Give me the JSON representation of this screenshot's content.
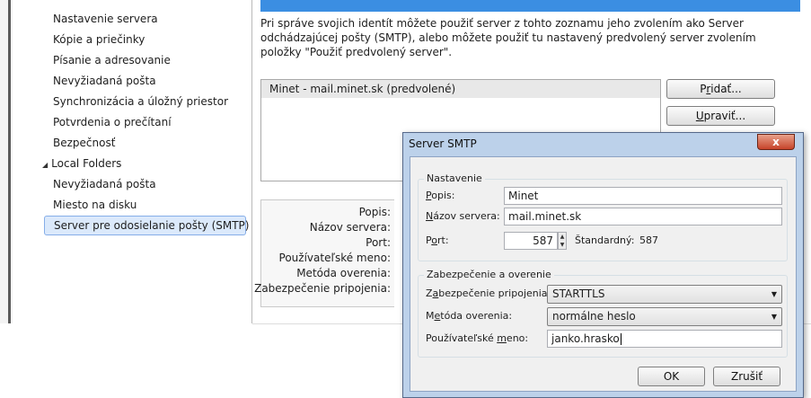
{
  "tree": {
    "items": [
      {
        "label": "Nastavenie servera"
      },
      {
        "label": "Kópie a priečinky"
      },
      {
        "label": "Písanie a adresovanie"
      },
      {
        "label": "Nevyžiadaná pošta"
      },
      {
        "label": "Synchronizácia a úložný priestor"
      },
      {
        "label": "Potvrdenia o prečítaní"
      },
      {
        "label": "Bezpečnosť"
      }
    ],
    "root": {
      "label": "Local Folders",
      "arrow": "◢"
    },
    "local_items": [
      {
        "label": "Nevyžiadaná pošta"
      },
      {
        "label": "Miesto na disku"
      }
    ],
    "selected": {
      "label": "Server pre odosielanie pošty (SMTP)"
    }
  },
  "main": {
    "description": "Pri správe svojich identít môžete použiť server z tohto zoznamu jeho zvolením ako Server odchádzajúcej pošty (SMTP), alebo môžete použiť tu nastavený predvolený server zvolením položky \"Použiť predvolený server\".",
    "server_list": [
      "Minet - mail.minet.sk (predvolené)"
    ],
    "add_button": {
      "pre": "P",
      "key": "r",
      "post": "idať..."
    },
    "edit_button": {
      "pre": "",
      "key": "U",
      "post": "praviť..."
    },
    "detail_labels": [
      "Popis:",
      "Názov servera:",
      "Port:",
      "Používateľské meno:",
      "Metóda overenia:",
      "Zabezpečenie pripojenia:"
    ]
  },
  "dialog": {
    "title": "Server SMTP",
    "close_glyph": "x",
    "settings_legend": "Nastavenie",
    "description_label": {
      "pre": "",
      "key": "P",
      "post": "opis:"
    },
    "description_value": "Minet",
    "server_label": {
      "pre": "",
      "key": "N",
      "post": "ázov servera:"
    },
    "server_value": "mail.minet.sk",
    "port_label": {
      "pre": "P",
      "key": "o",
      "post": "rt:"
    },
    "port_value": "587",
    "default_label": "Štandardný:",
    "default_value": "587",
    "security_legend": "Zabezpečenie a overenie",
    "security_label": {
      "pre": "Z",
      "key": "a",
      "post": "bezpečenie pripojenia:"
    },
    "security_value": "STARTTLS",
    "auth_label": {
      "pre": "M",
      "key": "e",
      "post": "tóda overenia:"
    },
    "auth_value": "normálne heslo",
    "user_label": {
      "pre": "Používateľské ",
      "key": "m",
      "post": "eno:"
    },
    "user_value": "janko.hrasko",
    "ok_label": "OK",
    "cancel_label": "Zrušiť"
  }
}
